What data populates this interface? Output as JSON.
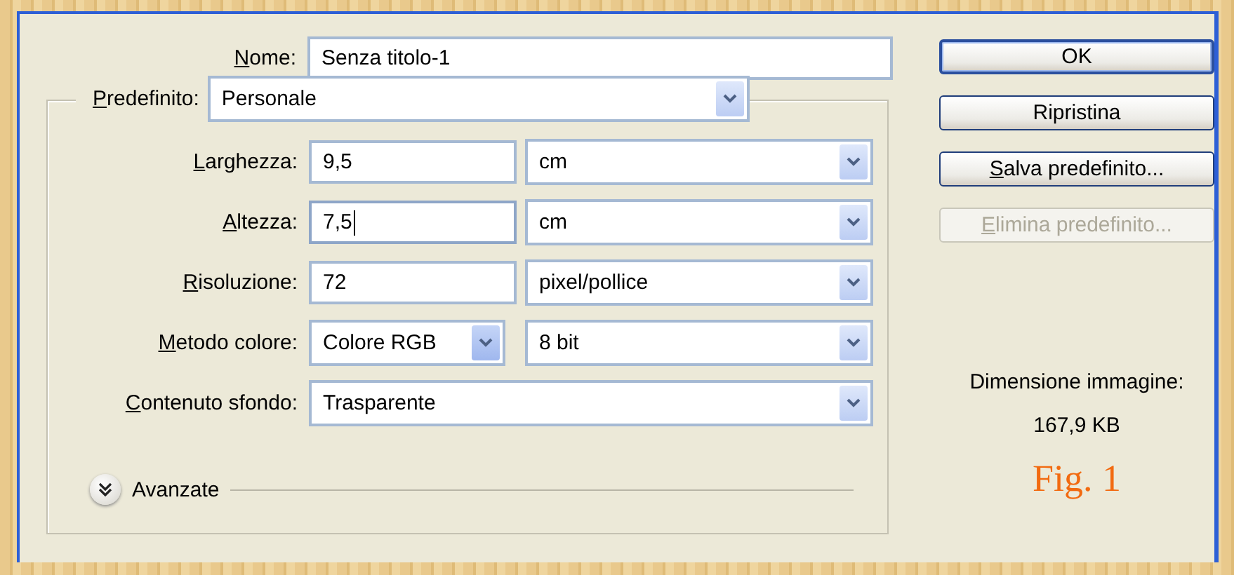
{
  "name_field": {
    "label": "Nome:",
    "value": "Senza titolo-1",
    "mnemonic": true
  },
  "preset": {
    "label": "Predefinito:",
    "value": "Personale",
    "mnemonic": true
  },
  "rows": [
    {
      "kind": "input-select",
      "label": "Larghezza:",
      "mnemonic": true,
      "value": "9,5",
      "focused": false,
      "unit": "cm"
    },
    {
      "kind": "input-select",
      "label": "Altezza:",
      "mnemonic": true,
      "value": "7,5",
      "focused": true,
      "unit": "cm"
    },
    {
      "kind": "input-select",
      "label": "Risoluzione:",
      "mnemonic": true,
      "value": "72",
      "focused": false,
      "unit": "pixel/pollice"
    },
    {
      "kind": "select-select",
      "label": "Metodo colore:",
      "mnemonic": true,
      "value": "Colore RGB",
      "focused": false,
      "unit": "8 bit"
    },
    {
      "kind": "select",
      "label": "Contenuto sfondo:",
      "mnemonic": true,
      "value": "Trasparente",
      "focused": false
    }
  ],
  "advanced": {
    "label": "Avanzate",
    "expanded": false
  },
  "buttons": [
    {
      "label": "OK",
      "default": true,
      "disabled": false,
      "mnemonic": false
    },
    {
      "label": "Ripristina",
      "default": false,
      "disabled": false,
      "mnemonic": false
    },
    {
      "label": "Salva predefinito...",
      "default": false,
      "disabled": false,
      "mnemonic": true
    },
    {
      "label": "Elimina predefinito...",
      "default": false,
      "disabled": true,
      "mnemonic": true
    }
  ],
  "image_size": {
    "label": "Dimensione immagine:",
    "value": "167,9 KB"
  },
  "caption": "Fig. 1"
}
